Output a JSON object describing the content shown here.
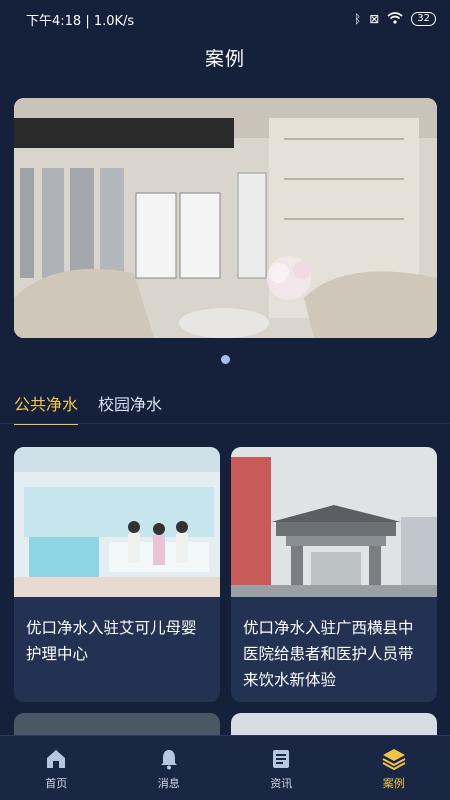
{
  "status_bar": {
    "time_speed": "下午4:18 | 1.0K/s",
    "battery": "32"
  },
  "page": {
    "title": "案例"
  },
  "banner": {
    "image_desc": "reception-room-photo"
  },
  "tabs": [
    {
      "label": "公共净水",
      "active": true
    },
    {
      "label": "校园净水",
      "active": false
    }
  ],
  "cases": [
    {
      "caption": "优口净水入驻艾可儿母婴护理中心",
      "image_desc": "nursing-center-photo"
    },
    {
      "caption": "优口净水入驻广西横县中医院给患者和医护人员带来饮水新体验",
      "image_desc": "hospital-gate-photo"
    }
  ],
  "bottom_nav": [
    {
      "label": "首页",
      "icon": "home-icon",
      "active": false
    },
    {
      "label": "消息",
      "icon": "bell-icon",
      "active": false
    },
    {
      "label": "资讯",
      "icon": "news-icon",
      "active": false
    },
    {
      "label": "案例",
      "icon": "layers-icon",
      "active": true
    }
  ],
  "colors": {
    "background": "#15213a",
    "accent": "#f2c44a",
    "card": "#233252"
  }
}
